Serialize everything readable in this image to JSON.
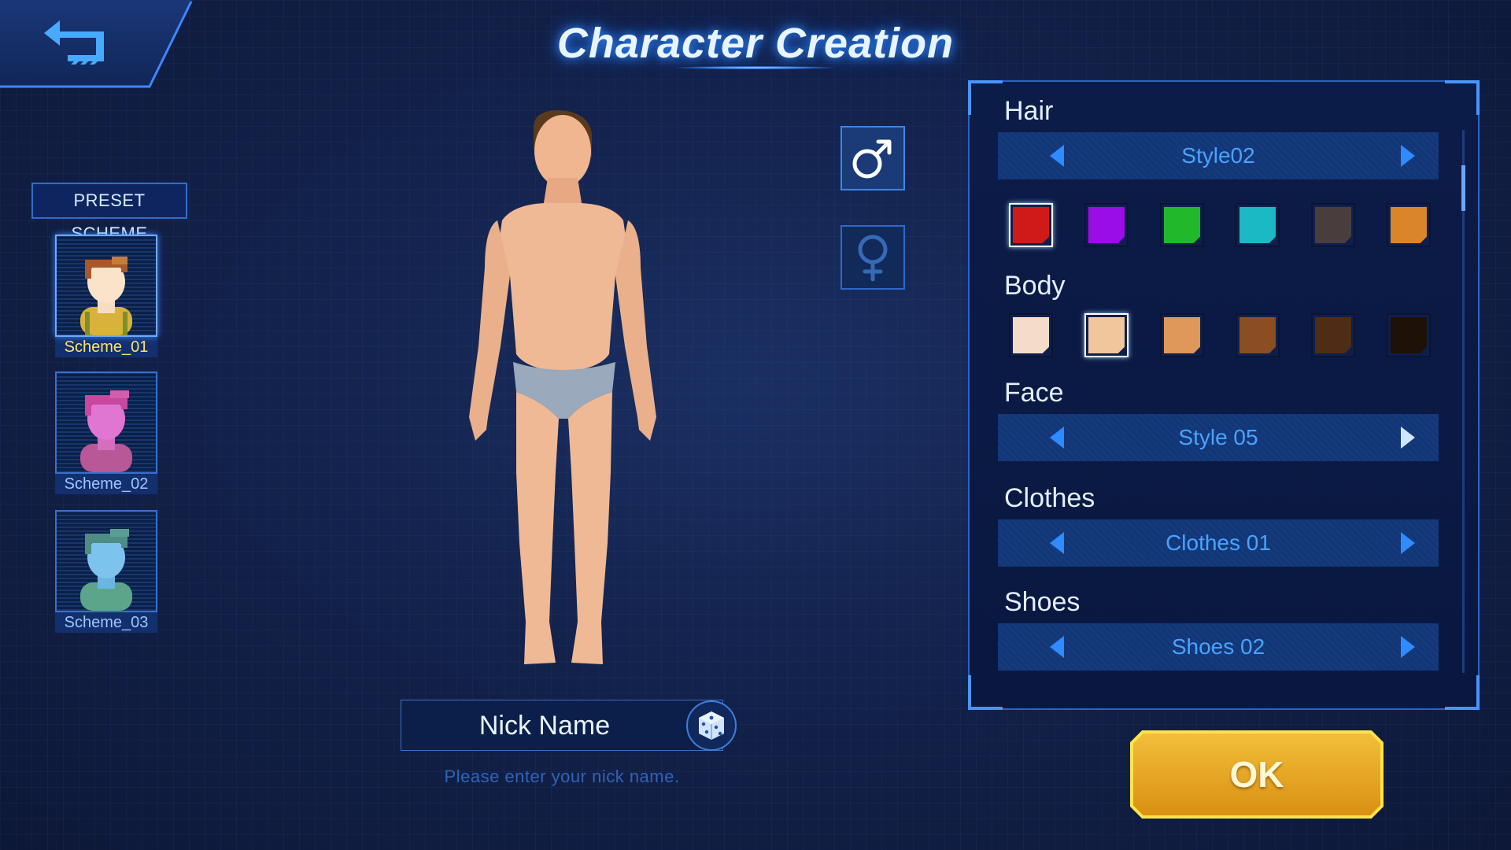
{
  "title": "Character Creation",
  "preset": {
    "label": "PRESET SCHEME",
    "schemes": [
      {
        "name": "Scheme_01",
        "tint": "#f2b64a"
      },
      {
        "name": "Scheme_02",
        "tint": "#d64aa8"
      },
      {
        "name": "Scheme_03",
        "tint": "#5aa8a0"
      }
    ],
    "selected": "Scheme_01"
  },
  "gender": {
    "selected": "male",
    "male_icon": "male-symbol-icon",
    "female_icon": "female-symbol-icon"
  },
  "nickname": {
    "placeholder": "Nick Name",
    "hint": "Please enter your nick name."
  },
  "panel": {
    "hair": {
      "label": "Hair",
      "style": "Style02",
      "colors": [
        "#d01a1a",
        "#9b0de6",
        "#22b82c",
        "#1ab9c4",
        "#4a3d3d",
        "#d9862a"
      ],
      "selected_color": 0
    },
    "body": {
      "label": "Body",
      "colors": [
        "#f4dccb",
        "#f0c79c",
        "#e0975a",
        "#8a4e22",
        "#4e2d14",
        "#1e1108"
      ],
      "selected_color": 1
    },
    "face": {
      "label": "Face",
      "style": "Style 05"
    },
    "clothes": {
      "label": "Clothes",
      "style": "Clothes 01"
    },
    "shoes": {
      "label": "Shoes",
      "style": "Shoes 02"
    }
  },
  "ok_label": "OK",
  "colors": {
    "accent": "#2f8bff",
    "ok_gold": "#e9a81e",
    "selected_scheme_text": "#ffe56a"
  }
}
